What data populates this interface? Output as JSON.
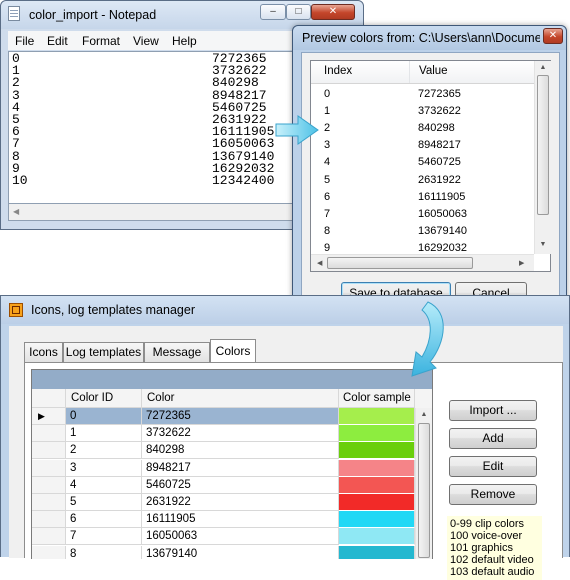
{
  "notepad": {
    "title": "color_import - Notepad",
    "menu": [
      "File",
      "Edit",
      "Format",
      "View",
      "Help"
    ],
    "lines": [
      {
        "index": "0",
        "value": "7272365"
      },
      {
        "index": "1",
        "value": "3732622"
      },
      {
        "index": "2",
        "value": "840298"
      },
      {
        "index": "3",
        "value": "8948217"
      },
      {
        "index": "4",
        "value": "5460725"
      },
      {
        "index": "5",
        "value": "2631922"
      },
      {
        "index": "6",
        "value": "16111905"
      },
      {
        "index": "7",
        "value": "16050063"
      },
      {
        "index": "8",
        "value": "13679140"
      },
      {
        "index": "9",
        "value": "16292032"
      },
      {
        "index": "10",
        "value": "12342400"
      }
    ],
    "caption_buttons": {
      "minimize": "–",
      "maximize": "□",
      "close": "✕"
    }
  },
  "preview": {
    "title": "Preview colors from: C:\\Users\\ann\\Documen...",
    "close_glyph": "✕",
    "columns": [
      "Index",
      "Value"
    ],
    "rows": [
      [
        "0",
        "7272365"
      ],
      [
        "1",
        "3732622"
      ],
      [
        "2",
        "840298"
      ],
      [
        "3",
        "8948217"
      ],
      [
        "4",
        "5460725"
      ],
      [
        "5",
        "2631922"
      ],
      [
        "6",
        "16111905"
      ],
      [
        "7",
        "16050063"
      ],
      [
        "8",
        "13679140"
      ],
      [
        "9",
        "16292032"
      ]
    ],
    "save_label": "Save to database",
    "cancel_label": "Cancel"
  },
  "manager": {
    "title": "Icons, log templates manager",
    "tabs": [
      "Icons",
      "Log templates",
      "Message list",
      "Colors"
    ],
    "active_tab": "Colors",
    "grid_columns": [
      "Color ID",
      "Color",
      "Color sample"
    ],
    "current_row_marker": "▶",
    "rows": [
      {
        "id": "0",
        "color": "7272365",
        "sample": "#a5ee4c"
      },
      {
        "id": "1",
        "color": "3732622",
        "sample": "#8ded3f"
      },
      {
        "id": "2",
        "color": "840298",
        "sample": "#6acf0c"
      },
      {
        "id": "3",
        "color": "8948217",
        "sample": "#f58488"
      },
      {
        "id": "4",
        "color": "5460725",
        "sample": "#f35653"
      },
      {
        "id": "5",
        "color": "2631922",
        "sample": "#f22a28"
      },
      {
        "id": "6",
        "color": "16111905",
        "sample": "#21d8f5"
      },
      {
        "id": "7",
        "color": "16050063",
        "sample": "#8fe8f4"
      },
      {
        "id": "8",
        "color": "13679140",
        "sample": "#24b8d0"
      }
    ],
    "buttons": {
      "import": "Import ...",
      "add": "Add",
      "edit": "Edit",
      "remove": "Remove"
    },
    "legend": [
      "0-99 clip colors",
      "100 voice-over",
      "101 graphics",
      "102 default video",
      "103 default audio"
    ],
    "colors": {
      "selection": "#9ab4d1",
      "grid_header_band": "#93acc8",
      "legend_bg": "#ffffe0"
    }
  }
}
